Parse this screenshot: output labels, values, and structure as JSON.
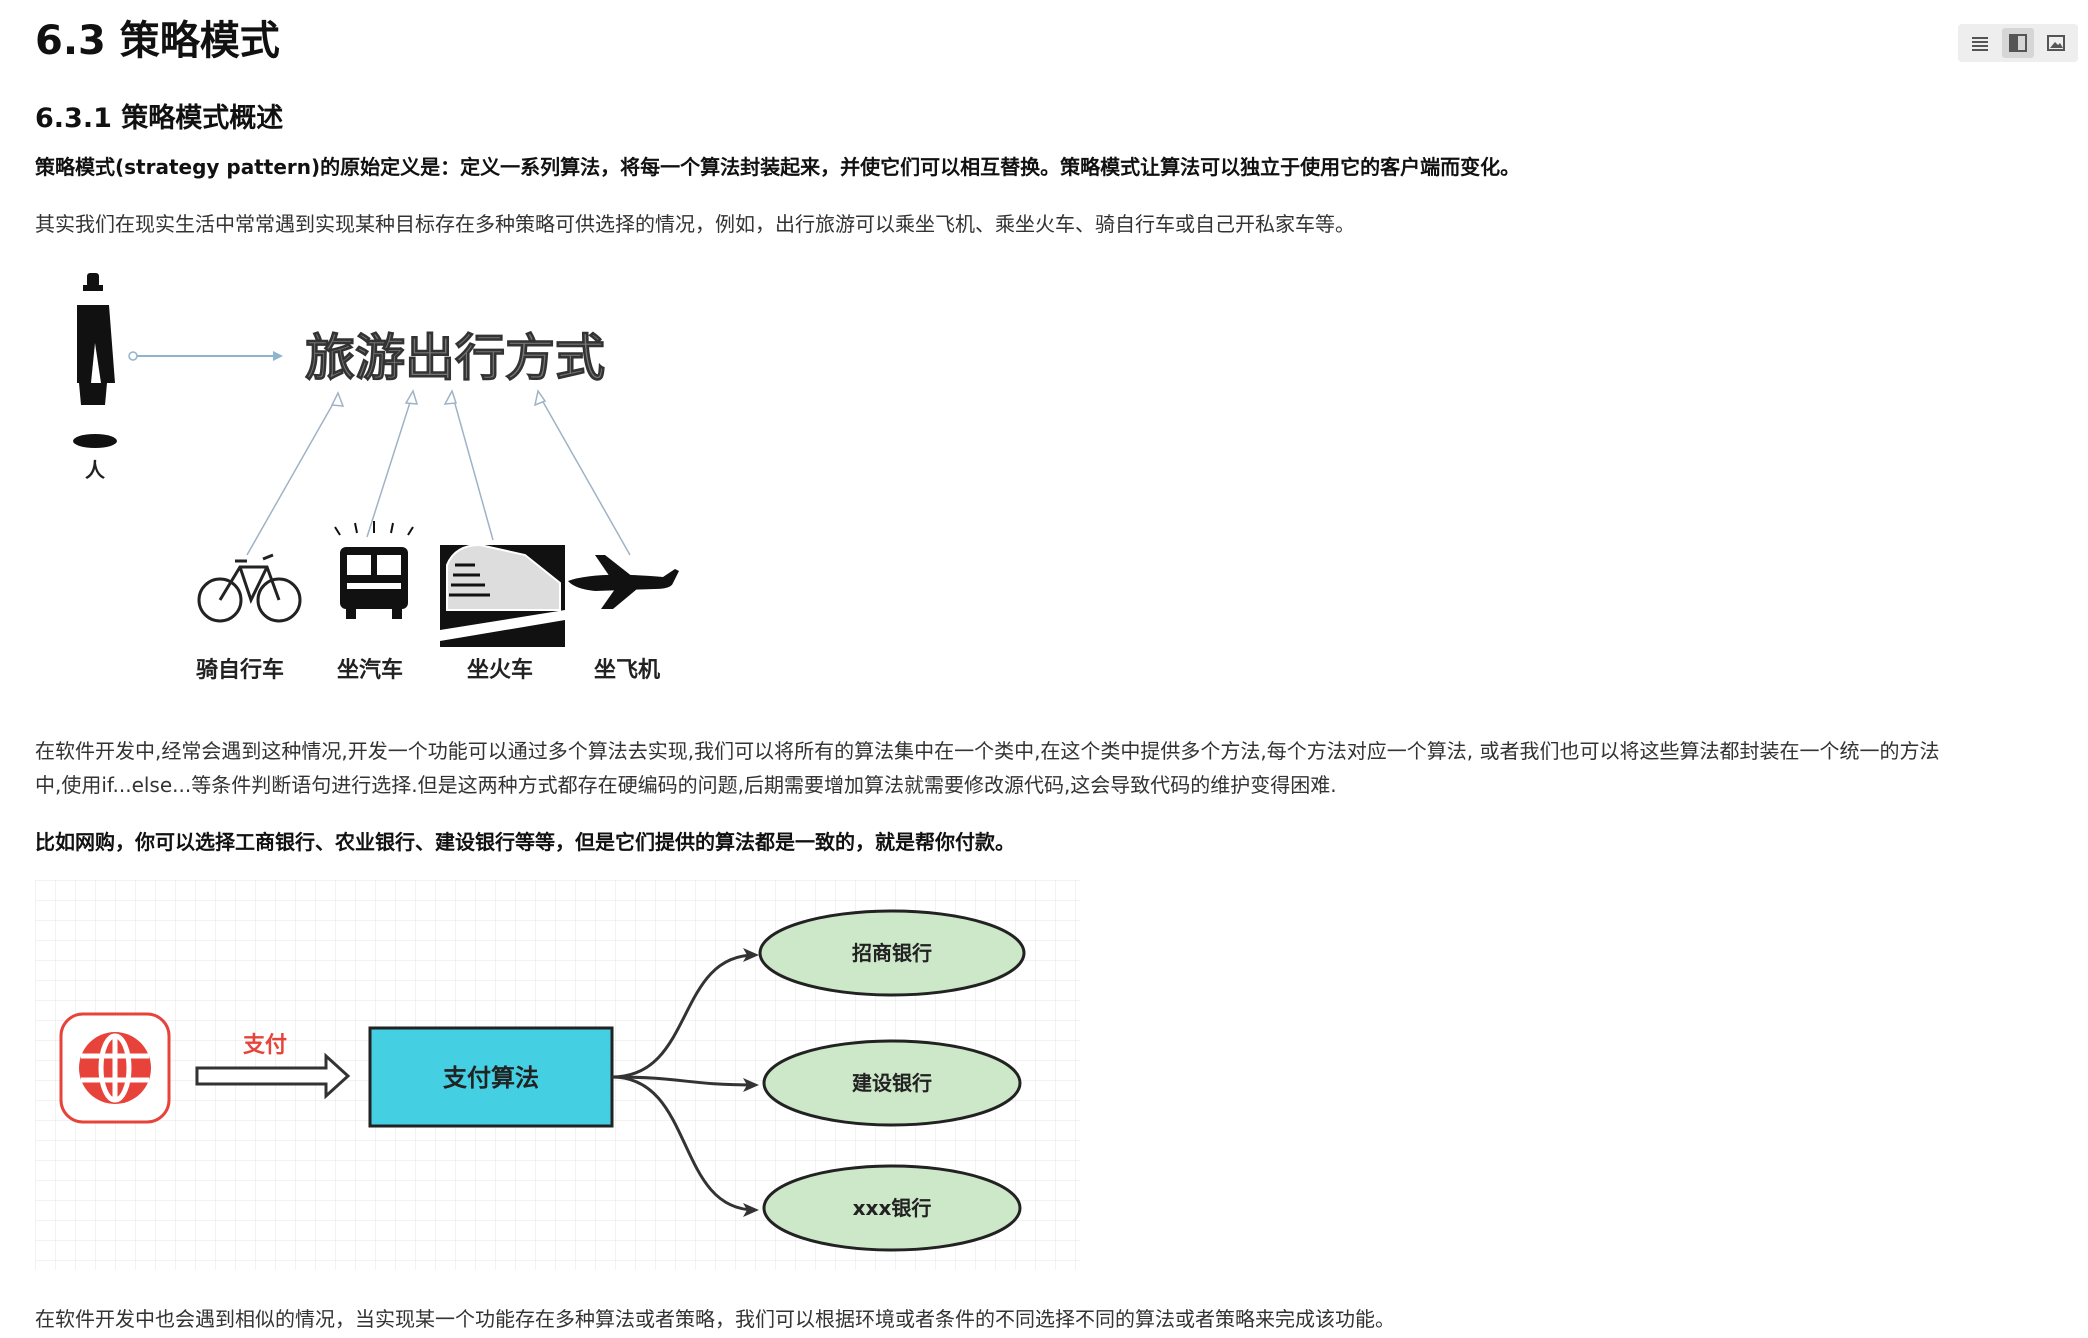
{
  "heading": "6.3 策略模式",
  "subheading": "6.3.1 策略模式概述",
  "para_definition": "策略模式(strategy pattern)的原始定义是：定义一系列算法，将每一个算法封装起来，并使它们可以相互替换。策略模式让算法可以独立于使用它的客户端而变化。",
  "para_example": "其实我们在现实生活中常常遇到实现某种目标存在多种策略可供选择的情况，例如，出行旅游可以乘坐飞机、乘坐火车、骑自行车或自己开私家车等。",
  "travel_figure": {
    "title": "旅游出行方式",
    "person": "人",
    "options": [
      "骑自行车",
      "坐汽车",
      "坐火车",
      "坐飞机"
    ]
  },
  "para_software_1": "在软件开发中,经常会遇到这种情况,开发一个功能可以通过多个算法去实现,我们可以将所有的算法集中在一个类中,在这个类中提供多个方法,每个方法对应一个算法, 或者我们也可以将这些算法都封装在一个统一的方法",
  "para_software_2": "中,使用if...else...等条件判断语句进行选择.但是这两种方式都存在硬编码的问题,后期需要增加算法就需要修改源代码,这会导致代码的维护变得困难.",
  "para_shopping": "比如网购，你可以选择工商银行、农业银行、建设银行等等，但是它们提供的算法都是一致的，就是帮你付款。",
  "payment_figure": {
    "arrow_label": "支付",
    "box_label": "支付算法",
    "banks": [
      "招商银行",
      "建设银行",
      "xxx银行"
    ],
    "colors": {
      "globe": "#e8433a",
      "box": "#44cfe3",
      "bank": "#cde8c9",
      "arrow_label": "#e8433a"
    }
  },
  "para_last": "在软件开发中也会遇到相似的情况，当实现某一个功能存在多种算法或者策略，我们可以根据环境或者条件的不同选择不同的算法或者策略来完成该功能。",
  "toolbar": {
    "icons": [
      "list-icon",
      "panel-icon",
      "image-icon"
    ],
    "active": "panel-icon"
  }
}
